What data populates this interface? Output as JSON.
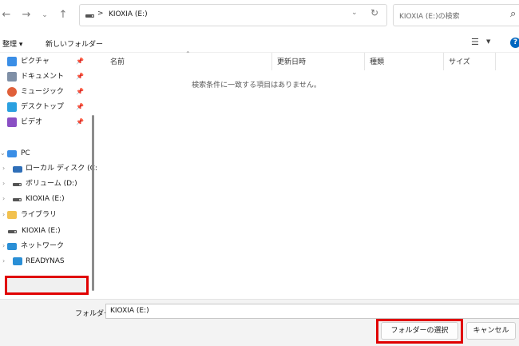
{
  "address_bar": {
    "back_icon": "arrow-left-icon",
    "forward_icon": "arrow-right-icon",
    "history_icon": "chevron-down-icon",
    "up_icon": "arrow-up-icon",
    "path_separator": ">",
    "path_text": "KIOXIA (E:)",
    "search_placeholder": "KIOXIA (E:)の検索"
  },
  "command_bar": {
    "organize_label": "整理 ▾",
    "new_folder_label": "新しいフォルダー"
  },
  "nav_pane": {
    "quick_access": [
      {
        "label": "ピクチャ",
        "icon": "pictures-icon"
      },
      {
        "label": "ドキュメント",
        "icon": "documents-icon"
      },
      {
        "label": "ミュージック",
        "icon": "music-icon"
      },
      {
        "label": "デスクトップ",
        "icon": "desktop-icon"
      },
      {
        "label": "ビデオ",
        "icon": "videos-icon"
      }
    ],
    "pc_label": "PC",
    "drives": [
      {
        "label": "ローカル ディスク (C:)"
      },
      {
        "label": "ボリューム (D:)"
      },
      {
        "label": "KIOXIA (E:)"
      }
    ],
    "library_label": "ライブラリ",
    "selected_label": "KIOXIA (E:)",
    "network_label": "ネットワーク",
    "readynas_label": "READYNAS"
  },
  "content": {
    "columns": [
      "名前",
      "更新日時",
      "種類",
      "サイズ"
    ],
    "empty_message": "検索条件に一致する項目はありません。"
  },
  "footer": {
    "folder_label": "フォルダー:",
    "folder_value": "KIOXIA (E:)",
    "select_button": "フォルダーの選択",
    "cancel_button": "キャンセル"
  },
  "colors": {
    "highlight": "#e00000",
    "accent": "#0067c0"
  }
}
